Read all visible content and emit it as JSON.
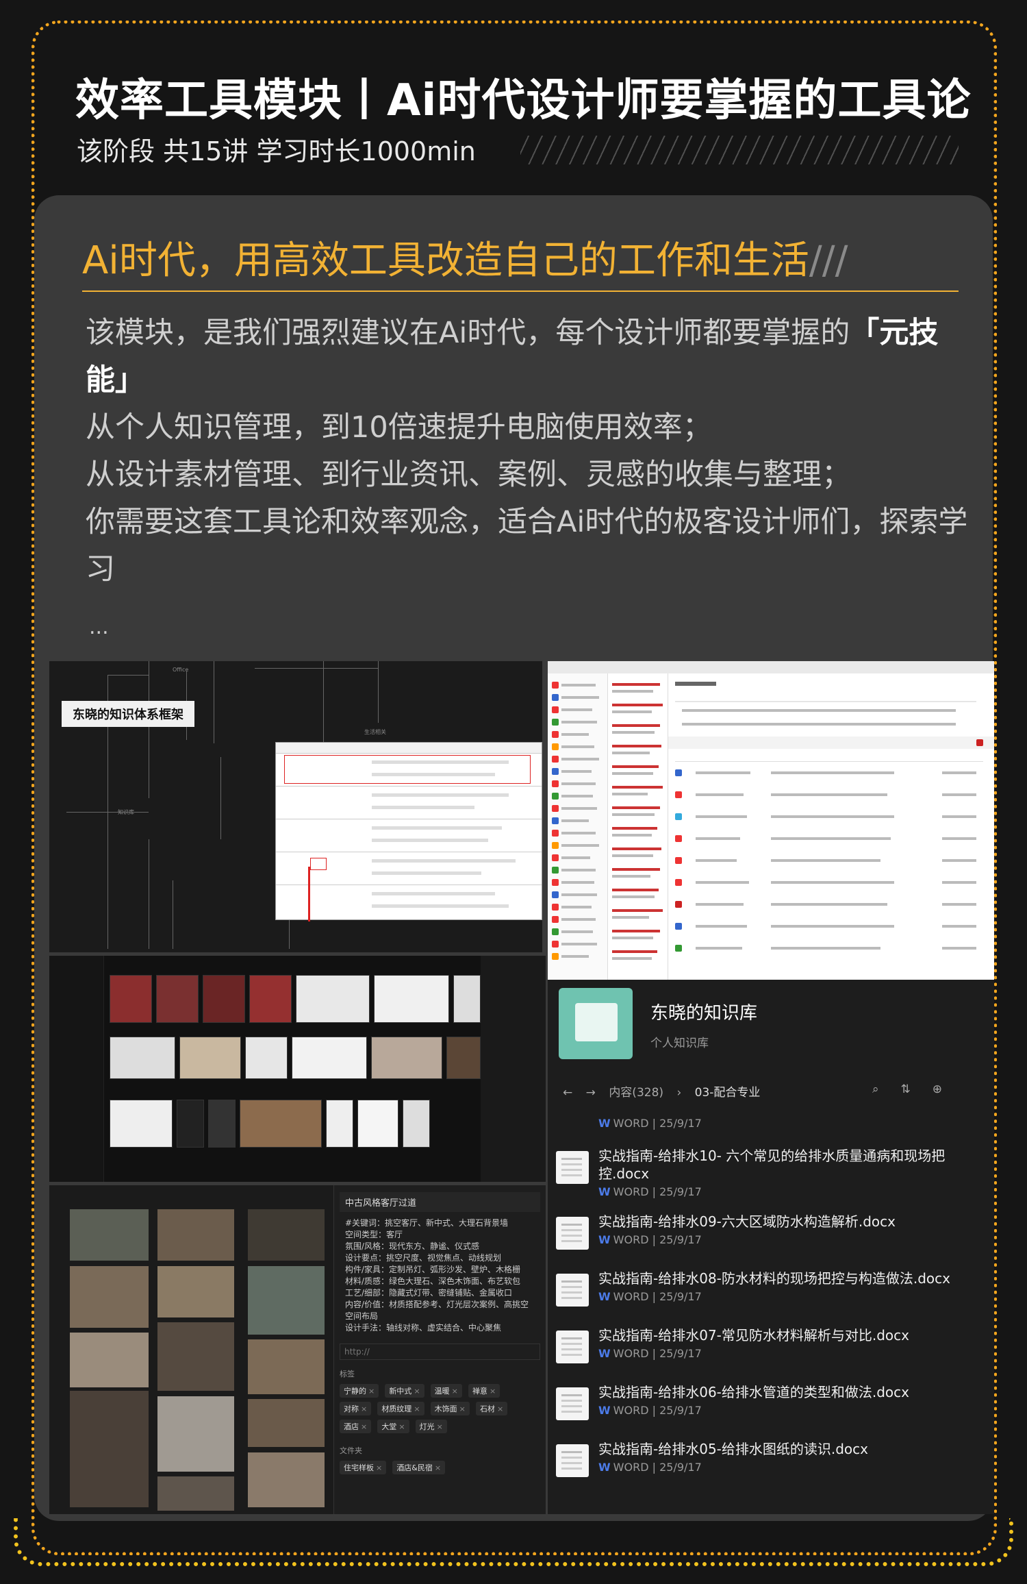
{
  "header": {
    "title": "效率工具模块丨Ai时代设计师要掌握的工具论",
    "subtitle": "该阶段 共15讲 学习时长1000min"
  },
  "card": {
    "heading": "Ai时代，用高效工具改造自己的工作和生活",
    "heading_slashes": "///",
    "para1_a": "该模块，是我们强烈建议在Ai时代，每个设计师都要掌握的",
    "para1_b": "「元技能」",
    "line2": "从个人知识管理，到10倍速提升电脑使用效率；",
    "line3": "从设计素材管理、到行业资讯、案例、灵感的收集与整理；",
    "line4": "你需要这套工具论和效率观念，适合Ai时代的极客设计师们，探索学习",
    "ellipsis": "..."
  },
  "mindmap": {
    "label": "东晓的知识体系框架"
  },
  "interior": {
    "title": "中古风格客厅过道",
    "description": "#关键词：挑空客厅、新中式、大理石背景墙\n空间类型：客厅\n氛围/风格：现代东方、静谧、仪式感\n设计要点：挑空尺度、视觉焦点、动线规划\n构件/家具：定制吊灯、弧形沙发、壁炉、木格栅\n材料/质感：绿色大理石、深色木饰面、布艺软包\n工艺/细部：隐藏式灯带、密缝铺贴、金属收口\n内容/价值：材质搭配参考、灯光层次案例、高挑空空间布局\n设计手法：轴线对称、虚实结合、中心聚焦",
    "url_placeholder": "http://",
    "tags_label": "标签",
    "tags": [
      "宁静的",
      "新中式",
      "温暖",
      "禅意",
      "对称",
      "材质纹理",
      "木饰面",
      "石材",
      "酒店",
      "大堂",
      "灯光"
    ],
    "folder_label": "文件夹",
    "folders": [
      "住宅样板",
      "酒店&民宿"
    ]
  },
  "knowledge_base": {
    "name": "东晓的知识库",
    "desc": "个人知识库",
    "nav_count": "内容(328)",
    "nav_folder": "03-配合专业",
    "first_meta_type": "WORD",
    "first_meta_date": "25/9/17",
    "items": [
      {
        "title": "实战指南-给排水10- 六个常见的给排水质量通病和现场把控.docx",
        "type": "WORD",
        "date": "25/9/17"
      },
      {
        "title": "实战指南-给排水09-六大区域防水构造解析.docx",
        "type": "WORD",
        "date": "25/9/17"
      },
      {
        "title": "实战指南-给排水08-防水材料的现场把控与构造做法.docx",
        "type": "WORD",
        "date": "25/9/17"
      },
      {
        "title": "实战指南-给排水07-常见防水材料解析与对比.docx",
        "type": "WORD",
        "date": "25/9/17"
      },
      {
        "title": "实战指南-给排水06-给排水管道的类型和做法.docx",
        "type": "WORD",
        "date": "25/9/17"
      },
      {
        "title": "实战指南-给排水05-给排水图纸的读识.docx",
        "type": "WORD",
        "date": "25/9/17"
      }
    ]
  },
  "colors": {
    "accent": "#f2b234",
    "border": "#f2a51e",
    "teal": "#6fc3b0"
  }
}
